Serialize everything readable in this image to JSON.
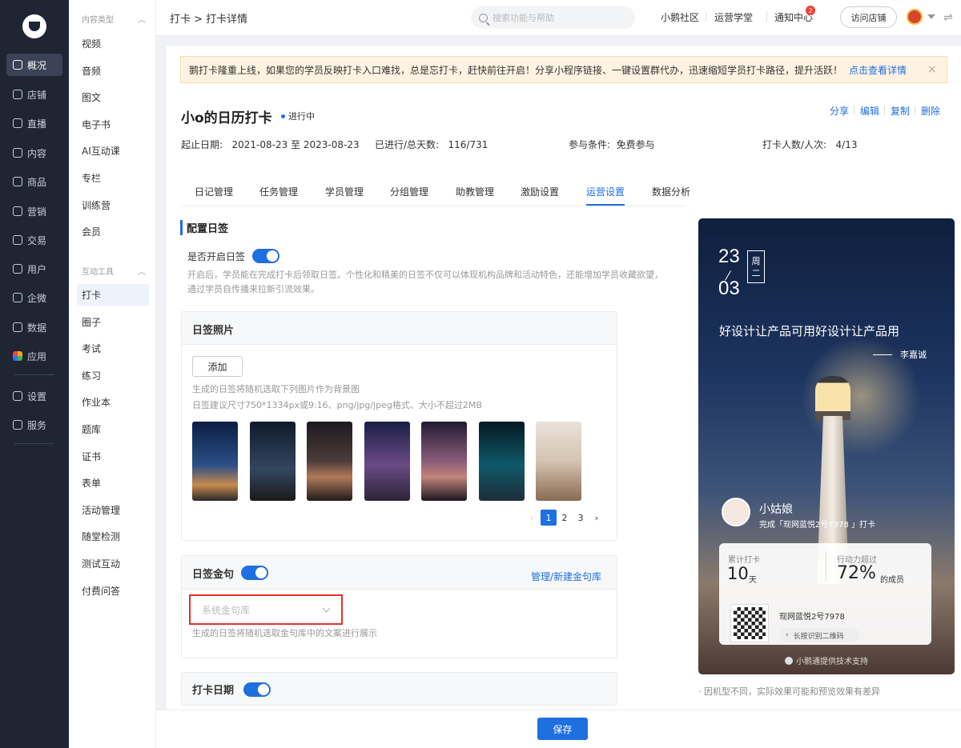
{
  "rail": {
    "items": [
      {
        "label": "概况",
        "icon": "pie-chart-icon"
      },
      {
        "label": "店铺",
        "icon": "store-icon"
      },
      {
        "label": "直播",
        "icon": "live-icon"
      },
      {
        "label": "内容",
        "icon": "document-icon"
      },
      {
        "label": "商品",
        "icon": "goods-icon"
      },
      {
        "label": "营销",
        "icon": "megaphone-icon"
      },
      {
        "label": "交易",
        "icon": "trade-icon"
      },
      {
        "label": "用户",
        "icon": "user-icon"
      },
      {
        "label": "企微",
        "icon": "wecom-icon"
      },
      {
        "label": "数据",
        "icon": "data-icon"
      },
      {
        "label": "应用",
        "icon": "apps-icon"
      },
      {
        "label": "设置",
        "icon": "gear-icon"
      },
      {
        "label": "服务",
        "icon": "service-icon"
      }
    ],
    "active_label": "概况"
  },
  "subnav": {
    "section1": "内容类型",
    "items1": [
      "视频",
      "音频",
      "图文",
      "电子书",
      "AI互动课",
      "专栏",
      "训练营",
      "会员"
    ],
    "section2": "互动工具",
    "items2": [
      "打卡",
      "圈子",
      "考试",
      "练习",
      "作业本",
      "题库",
      "证书",
      "表单",
      "活动管理",
      "随堂检测",
      "测试互动",
      "付费问答"
    ],
    "active": "打卡"
  },
  "header": {
    "breadcrumb": "打卡 > 打卡详情",
    "search_placeholder": "搜索功能与帮助",
    "links": [
      "小鹅社区",
      "运营学堂",
      "通知中心"
    ],
    "notice_count": "2",
    "visit_label": "访问店铺"
  },
  "notice": {
    "text": "鹅打卡隆重上线，如果您的学员反映打卡入口难找，总是忘打卡，赶快前往开启！分享小程序链接、一键设置群代办，迅速缩短学员打卡路径，提升活跃！",
    "link": "点击查看详情",
    "close": "×"
  },
  "detail": {
    "title": "小o的日历打卡",
    "status": "进行中",
    "actions": [
      "分享",
      "编辑",
      "复制",
      "删除"
    ],
    "date_range": "起止日期:   2021-08-23 至 2023-08-23",
    "progress": "已进行/总天数:   116/731",
    "condition": "参与条件:  免费参与",
    "people": "打卡人数/人次:   4/13"
  },
  "tabs": [
    "日记管理",
    "任务管理",
    "学员管理",
    "分组管理",
    "助教管理",
    "激励设置",
    "运营设置",
    "数据分析"
  ],
  "active_tab": "运营设置",
  "config": {
    "title": "配置日签",
    "enable_label": "是否开启日签",
    "enable_on": true,
    "enable_desc": "开启后，学员能在完成打卡后领取日签。个性化和精美的日签不仅可以体现机构品牌和活动特色，还能增加学员收藏欲望，通过学员自传播来拉新引流效果。",
    "photo_panel_title": "日签照片",
    "add_label": "添加",
    "photo_desc1": "生成的日签将随机选取下列图片作为背景图",
    "photo_desc2": "日签建议尺寸750*1334px或9:16、png/jpg/jpeg格式、大小不超过2MB",
    "pages": [
      "1",
      "2",
      "3"
    ],
    "active_page": "1",
    "quote_panel_title": "日签金句",
    "quote_on": true,
    "quote_manage": "管理/新建金句库",
    "quote_select_placeholder": "系统金句库",
    "quote_desc": "生成的日签将随机选取金句库中的文案进行展示",
    "date_panel_title": "打卡日期",
    "date_on": true
  },
  "preview": {
    "day": "23",
    "month": "03",
    "week1": "周",
    "week2": "二",
    "quote": "好设计让产品可用好设计让产品用",
    "author": "李嘉诚",
    "user_name": "小姑娘",
    "user_done": "完成「现网蓝悦2号7978 」打卡",
    "total_label": "累计打卡",
    "total_value": "10",
    "total_unit": "天",
    "beat_label": "行动力超过",
    "beat_value": "72%",
    "beat_unit": "的成员",
    "qr_title": "现网蓝悦2号7978",
    "qr_hint": "长按识别二维码",
    "support": "小鹅通提供技术支持",
    "note": "· 因机型不同，实际效果可能和预览效果有差异"
  },
  "save_label": "保存",
  "colors": {
    "accent": "#1e6fe0",
    "rail_bg": "#1f2533",
    "notice_bg": "#fef3e2",
    "highlight_border": "#e0302b"
  }
}
